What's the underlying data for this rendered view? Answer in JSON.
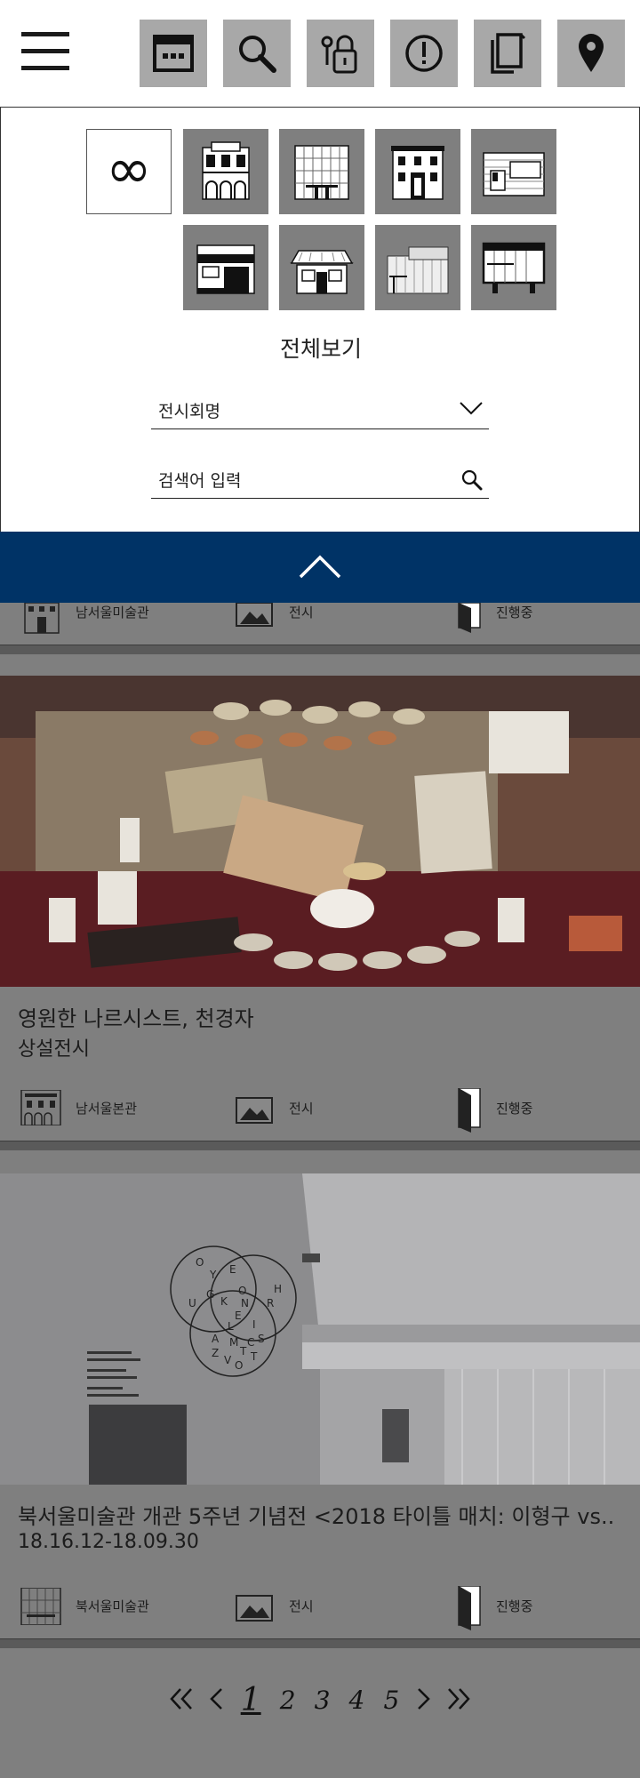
{
  "header": {
    "icons": [
      "menu-icon",
      "calendar-icon",
      "search-icon",
      "locker-icon",
      "notice-icon",
      "publication-icon",
      "location-pin-icon"
    ]
  },
  "filter": {
    "all_symbol": "∞",
    "caption": "전체보기",
    "exhibition_select": "전시회명",
    "search_placeholder": "검색어 입력",
    "venue_icons": [
      "seoul-museum-building-icon",
      "glass-building-icon",
      "nam-seoul-building-icon",
      "modern-building-icon",
      "shop-building-icon",
      "hanok-building-icon",
      "archive-building-icon",
      "box-building-icon"
    ]
  },
  "cards": [
    {
      "venue": "남서울미술관",
      "category": "전시",
      "status": "진행중"
    },
    {
      "title": "영원한 나르시스트, 천경자",
      "subtitle": "상설전시",
      "venue": "남서울본관",
      "category": "전시",
      "status": "진행중"
    },
    {
      "title": "북서울미술관 개관 5주년 기념전 <2018 타이틀 매치: 이형구 vs..",
      "subtitle": "18.16.12-18.09.30",
      "venue": "북서울미술관",
      "category": "전시",
      "status": "진행중",
      "wall_letters": [
        "O",
        "Y",
        "E",
        "G",
        "K",
        "O",
        "N",
        "U",
        "E",
        "L",
        "I",
        "A",
        "M",
        "C",
        "S",
        "T",
        "V",
        "O",
        "T",
        "Z",
        "R",
        "H"
      ]
    }
  ],
  "pagination": {
    "current": "1",
    "pages": [
      "2",
      "3",
      "4",
      "5"
    ]
  },
  "colors": {
    "accent": "#003366",
    "overlay": "#7f7f7f"
  }
}
